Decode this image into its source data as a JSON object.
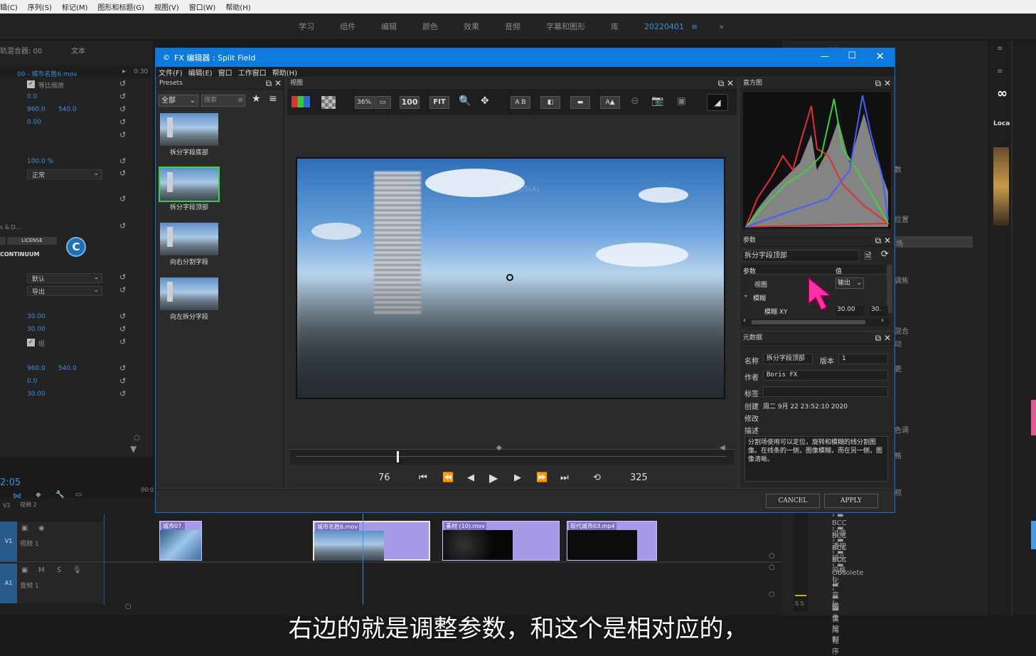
{
  "menubar": [
    "辑(C)",
    "序列(S)",
    "标记(M)",
    "图形和标题(G)",
    "视图(V)",
    "窗口(W)",
    "帮助(H)"
  ],
  "workspaces": [
    "学习",
    "组件",
    "编辑",
    "颜色",
    "效果",
    "音频",
    "字幕和图形",
    "库",
    "20220401"
  ],
  "effect_controls": {
    "mixer_label": "轨混合器: 00",
    "text_tab": "文本",
    "clip_name": "00 - 城市名胜6.mov",
    "time_label": "0:30",
    "uniform_scale": "等比缩放",
    "values": {
      "r1": "0.0",
      "pos_x": "960.0",
      "pos_y": "540.0",
      "r3": "0.00",
      "opacity": "100.0 %",
      "blend": "正常",
      "sd": "s & D...",
      "license": "LICENSE",
      "continuum": "CONTINUUM",
      "default": "默认",
      "export": "导出",
      "v30a": "30.00",
      "v30b": "30.00",
      "group": "组",
      "pos2_x": "960.0",
      "pos2_y": "540.0",
      "v0": "0.0",
      "v30c": "30.00"
    },
    "timecode": "2:05"
  },
  "fx_editor": {
    "title": "FX 编辑器 : Split Field",
    "menu": [
      "文件(F)",
      "编辑(E)",
      "窗口",
      "工作窗口",
      "帮助(H)"
    ],
    "presets_header": "Presets",
    "preset_filter": "全部",
    "preset_search": "搜索",
    "presets": [
      "拆分字段底部",
      "拆分字段顶部",
      "向右分割字段",
      "向左拆分字段"
    ],
    "viewer_header": "视图",
    "zoom": "36%",
    "btn_100": "100",
    "btn_fit": "FIT",
    "btn_ab": "A B",
    "viewer_overlay": "景宁城市(A)",
    "frame_start": "76",
    "frame_end": "325",
    "histogram_header": "直方图",
    "params_header": "参数",
    "params_preset": "拆分字段顶部",
    "params_col1": "参数",
    "params_col2": "值",
    "param_view": "视图",
    "param_view_value": "输出",
    "param_blur": "模糊",
    "param_blur_xy": "模糊 XY",
    "param_blur_x": "30.00",
    "param_blur_y": "30.",
    "metadata_header": "元数据",
    "md_name_label": "名称",
    "md_name": "拆分字段顶部",
    "md_version_label": "版本",
    "md_version": "1",
    "md_author_label": "作者",
    "md_author": "Boris FX",
    "md_tags_label": "标签",
    "md_created_label": "创建",
    "md_created": "周二 9月 22 23:52:10 2020",
    "md_modified_label": "修改",
    "md_desc_label": "描述",
    "md_desc": "分割场使用可以定位，旋转和模糊的线分割图像。在线条的一侧，图像模糊，而在另一侧，图像清晰。",
    "cancel": "CANCEL",
    "apply": "APPLY"
  },
  "right_panel": {
    "header": "效果",
    "loca": "Loca",
    "labels": [
      "数",
      "位置",
      "场",
      "调焦",
      "混合",
      "动",
      "更",
      "色调",
      "格",
      "视"
    ],
    "library": [
      "BCC 过渡",
      "BCC 透视",
      "BCC 镜头",
      "BCC 风格化",
      "Obsolete",
      "变换",
      "图像控制",
      "实用程序"
    ],
    "meter": "S S"
  },
  "timeline": {
    "v2": "V2",
    "v2_name": "视频 2",
    "v1": "V1",
    "v1_name": "视频 1",
    "a1": "A1",
    "a1_name": "音频 1",
    "ruler_start": "00:0",
    "clips": [
      "城市07.",
      "城市名胜6.mov",
      "素材 (10).mov",
      "现代城市03.mp4"
    ]
  },
  "subtitle": "右边的就是调整参数，和这个是相对应的，",
  "colors": {
    "accent": "#0d7bde",
    "clip": "#a79be8",
    "highlight": "#3e8fe0",
    "cursor": "#ff2fa8"
  }
}
